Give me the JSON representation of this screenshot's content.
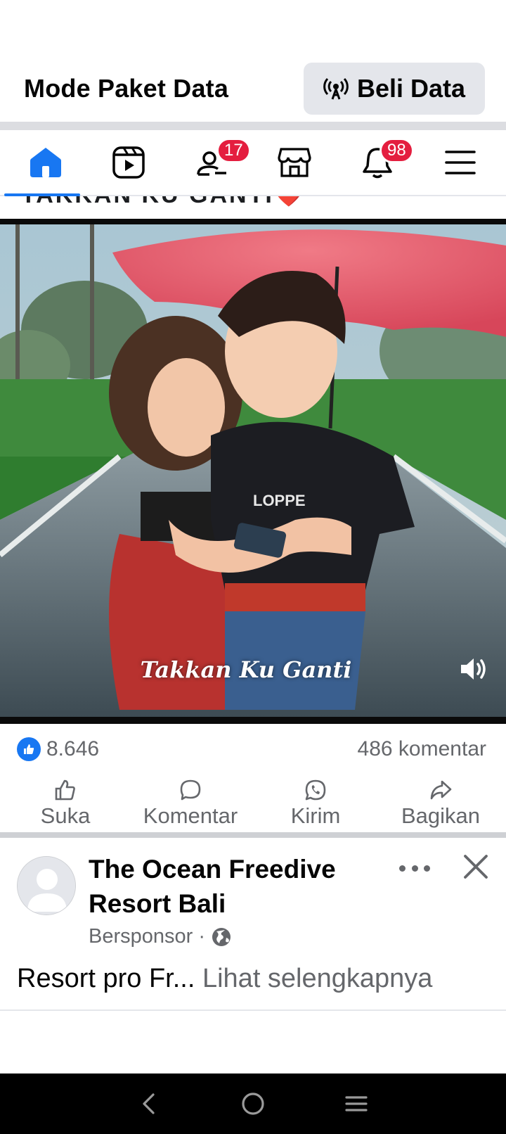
{
  "data_bar": {
    "title": "Mode Paket Data",
    "button_label": "Beli Data"
  },
  "nav": {
    "items": [
      {
        "name": "home",
        "icon": "home-icon",
        "active": true
      },
      {
        "name": "reels",
        "icon": "video-icon"
      },
      {
        "name": "friends",
        "icon": "friends-icon",
        "badge": "17"
      },
      {
        "name": "marketplace",
        "icon": "store-icon"
      },
      {
        "name": "notifications",
        "icon": "bell-icon",
        "badge": "98"
      },
      {
        "name": "menu",
        "icon": "menu-icon"
      }
    ],
    "accent": "#1877f2",
    "badge_color": "#e41e3f"
  },
  "feed_post": {
    "caption_clipped": "TAKKAN KU GANTI",
    "caption_emoji": "❤️",
    "video_overlay_text": "Takkan Ku Ganti",
    "reaction_count": "8.646",
    "comment_count": "486 komentar",
    "actions": [
      "Suka",
      "Komentar",
      "Kirim",
      "Bagikan"
    ]
  },
  "sponsored_post": {
    "page_name": "The Ocean Freedive Resort Bali",
    "sponsored_label": "Bersponsor",
    "separator": " · ",
    "text": "Resort pro Fr...",
    "see_more": "Lihat selengkapnya"
  },
  "system_nav": {
    "icons": [
      "back-icon",
      "home-circle-icon",
      "recents-icon"
    ]
  }
}
